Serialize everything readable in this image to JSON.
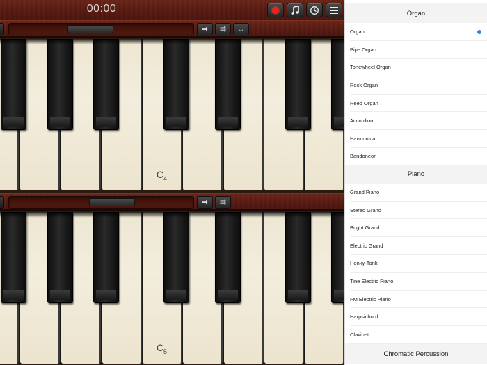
{
  "toolbar": {
    "time": "00:00",
    "icons": [
      "record-icon",
      "music-note-icon",
      "metronome-icon",
      "menu-icon"
    ],
    "record_color": "#ff1a14"
  },
  "keyboards": [
    {
      "label_note": "C",
      "label_octave": "4"
    },
    {
      "label_note": "C",
      "label_octave": "5"
    }
  ],
  "instrument_list": {
    "selected": "Organ",
    "selection_color": "#2a84f3",
    "sections": [
      {
        "title": "Organ",
        "items": [
          "Organ",
          "Pipe Organ",
          "Tonewheel Organ",
          "Rock Organ",
          "Reed Organ",
          "Accordion",
          "Harmonica",
          "Bandoneon"
        ]
      },
      {
        "title": "Piano",
        "items": [
          "Grand Piano",
          "Stereo Grand",
          "Bright Grand",
          "Electric Grand",
          "Honky-Tonk",
          "Tine Electric Piano",
          "FM Electric Piano",
          "Harpsichord",
          "Clavinet"
        ]
      },
      {
        "title": "Chromatic Percussion",
        "items": []
      }
    ]
  }
}
